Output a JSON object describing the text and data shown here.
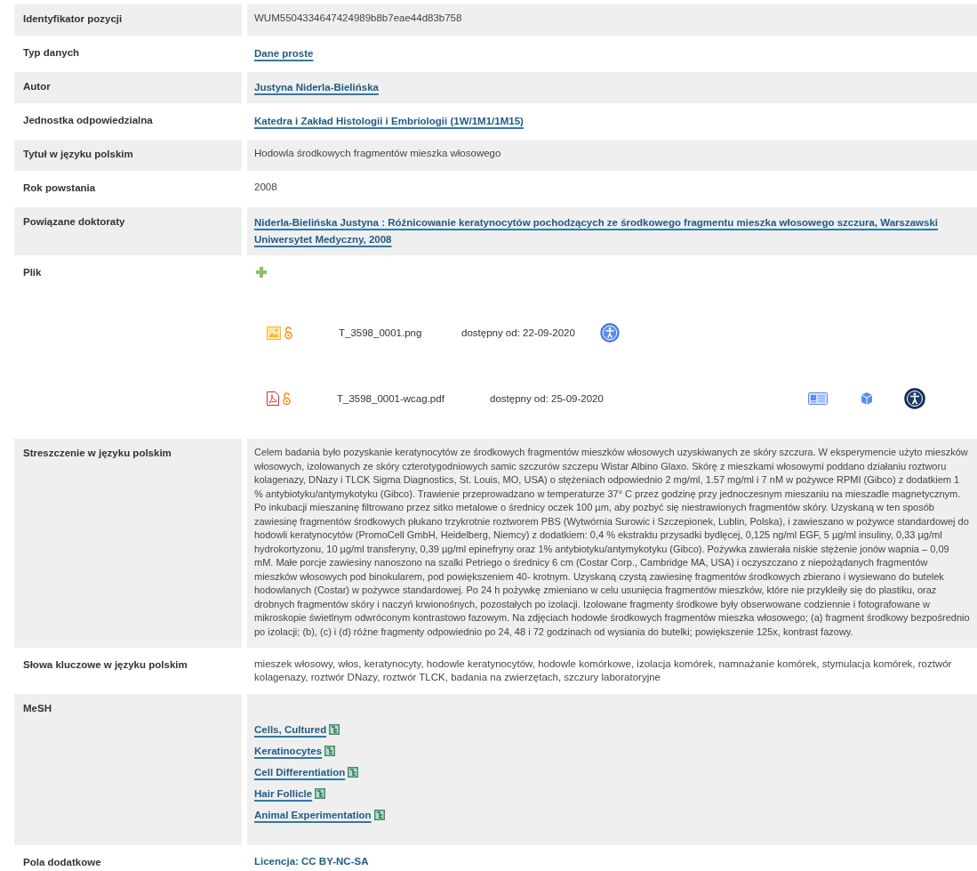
{
  "rows": [
    {
      "label": "Identyfikator pozycji",
      "kind": "text",
      "value": "WUM5504334647424989b8b7eae44d83b758"
    },
    {
      "label": "Typ danych",
      "kind": "link",
      "value": "Dane proste"
    },
    {
      "label": "Autor",
      "kind": "link",
      "value": "Justyna Niderla-Bielińska"
    },
    {
      "label": "Jednostka odpowiedzialna",
      "kind": "link",
      "value": "Katedra i Zakład Histologii i Embriologii (1W/1M1/1M15)"
    },
    {
      "label": "Tytuł w języku polskim",
      "kind": "text",
      "value": "Hodowla środkowych fragmentów mieszka włosowego"
    },
    {
      "label": "Rok powstania",
      "kind": "text",
      "value": "2008"
    },
    {
      "label": "Powiązane doktoraty",
      "kind": "link",
      "value": "Niderla-Bielińska Justyna : Różnicowanie keratynocytów pochodzących ze środkowego fragmentu mieszka włosowego szczura, Warszawski Uniwersytet Medyczny, 2008"
    },
    {
      "label": "Plik",
      "kind": "files",
      "files": [
        {
          "kind": "image",
          "name": "T_3598_0001.png",
          "available": "dostępny od: 22-09-2020"
        },
        {
          "kind": "pdf",
          "name": "T_3598_0001-wcag.pdf",
          "available": "dostępny od: 25-09-2020"
        }
      ]
    },
    {
      "label": "Streszczenie w języku polskim",
      "kind": "paragraph",
      "value": "Celem badania było pozyskanie keratynocytów ze środkowych fragmentów mieszków włosowych uzyskiwanych ze skóry szczura. W eksperymencie użyto mieszków włosowych, izolowanych ze skóry czterotygodniowych samic szczurów szczepu Wistar Albino Glaxo. Skórę z mieszkami włosowymi poddano działaniu roztworu kolagenazy, DNazy i TLCK Sigma Diagnostics, St. Louis, MO, USA) o stężeniach odpowiednio 2 mg/ml, 1.57 mg/ml i 7 nM w pożywce RPMI (Gibco) z dodatkiem 1 % antybiotyku/antymykotyku (Gibco). Trawienie przeprowadzano w temperaturze 37° C przez godzinę przy jednoczesnym mieszaniu na mieszadle magnetycznym. Po inkubacji mieszaninę filtrowano przez sitko metalowe o średnicy oczek 100 µm, aby pozbyć się niestrawionych fragmentów skóry. Uzyskaną w ten sposób zawiesinę fragmentów środkowych płukano trzykrotnie roztworem PBS (Wytwórnia Surowic i Szczepionek, Lublin, Polska), i zawieszano w pożywce standardowej do hodowli keratynocytów (PromoCell GmbH, Heidelberg, Niemcy) z dodatkiem: 0,4 % ekstraktu przysadki bydlęcej, 0,125 ng/ml EGF, 5 µg/ml insuliny, 0,33 µg/ml hydrokortyzonu, 10 µg/ml transferyny, 0,39 µg/ml epinefryny oraz 1% antybiotyku/antymykotyku (Gibco). Pożywka zawierała niskie stężenie jonów wapnia – 0,09 mM. Małe porcje zawiesiny nanoszono na szalki Petriego o średnicy 6 cm (Costar Corp., Cambridge MA, USA) i oczyszczano z niepożądanych fragmentów mieszków włosowych pod binokularem, pod powiększeniem 40- krotnym. Uzyskaną czystą zawiesinę fragmentów środkowych zbierano i wysiewano do butelek hodowlanych (Costar) w pożywce standardowej. Po 24 h pożywkę zmieniano w celu usunięcia fragmentów mieszków, które nie przykleiły się do plastiku, oraz drobnych fragmentów skóry i naczyń krwionośnych, pozostałych po izolacji. Izolowane fragmenty środkowe były obserwowane codziennie i fotografowane w mikroskopie świetlnym odwróconym kontrastowo fazowym. Na zdjęciach hodowle środkowych fragmentów mieszka włosowego; (a) fragment środkowy bezpośrednio po izolacji; (b), (c) i (d) różne fragmenty odpowiednio po 24, 48 i 72 godzinach od wysiania do butelki; powiększenie 125x, kontrast fazowy."
    },
    {
      "label": "Słowa kluczowe w języku polskim",
      "kind": "text",
      "value": "mieszek włosowy, włos, keratynocyty, hodowle keratynocytów, hodowle komórkowe, izolacja komórek, namnażanie komórek, stymulacja komórek, roztwór kolagenazy, roztwór DNazy, roztwór TLCK, badania na zwierzętach, szczury laboratoryjne"
    },
    {
      "label": "MeSH",
      "kind": "mesh",
      "terms": [
        "Cells, Cultured",
        "Keratinocytes",
        "Cell Differentiation",
        "Hair Follicle",
        "Animal Experimentation"
      ]
    },
    {
      "label": "Pola dodatkowe",
      "kind": "license",
      "value": "Licencja: CC BY-NC-SA"
    }
  ]
}
